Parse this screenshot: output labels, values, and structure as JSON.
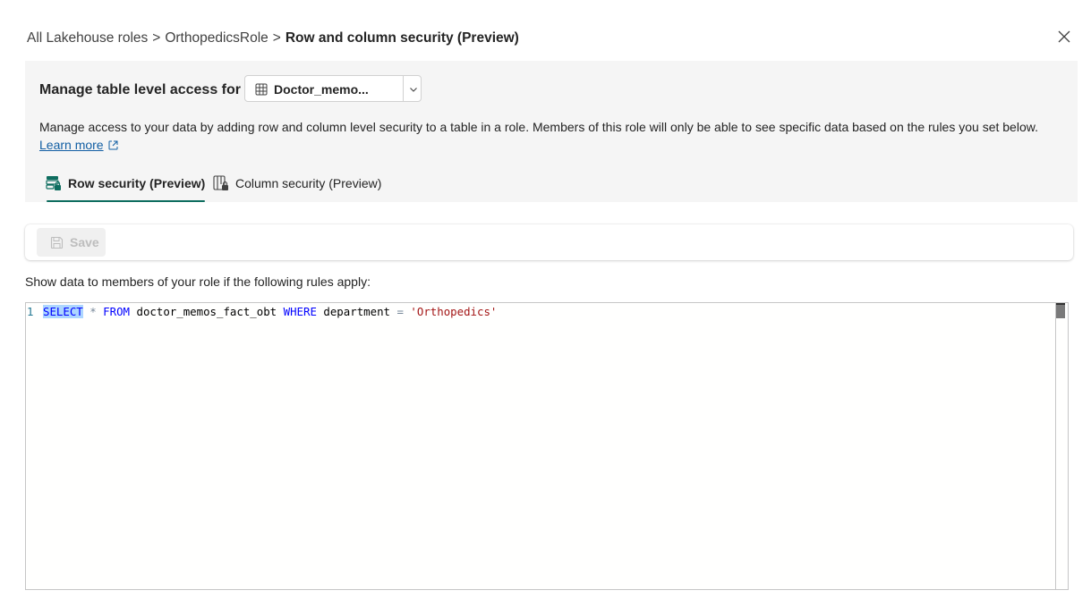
{
  "breadcrumb": {
    "item1": "All Lakehouse roles",
    "item2": "OrthopedicsRole",
    "current": "Row and column security (Preview)",
    "separator": ">"
  },
  "close": {
    "icon": "close-icon"
  },
  "manage": {
    "label": "Manage table level access for",
    "selected_table": "Doctor_memo...",
    "description": "Manage access to your data by adding row and column level security to a table in a role. Members of this role will only be able to see specific data based on the rules you set below.",
    "learn_more": "Learn more"
  },
  "tabs": [
    {
      "label": "Row security (Preview)",
      "icon": "row-security-icon",
      "selected": true
    },
    {
      "label": "Column security (Preview)",
      "icon": "column-security-icon",
      "selected": false
    }
  ],
  "toolbar": {
    "save_label": "Save",
    "save_disabled": true
  },
  "rules_label": "Show data to members of your role if the following rules apply:",
  "editor": {
    "line_number": "1",
    "tokens": {
      "select": "SELECT",
      "star": "*",
      "from": "FROM",
      "table": "doctor_memos_fact_obt",
      "where": "WHERE",
      "column": "department",
      "eq": "=",
      "value": "'Orthopedics'"
    }
  },
  "colors": {
    "accent": "#0e6d5f",
    "keyword": "#0000ff",
    "string": "#a31515",
    "link": "#115ea3"
  }
}
